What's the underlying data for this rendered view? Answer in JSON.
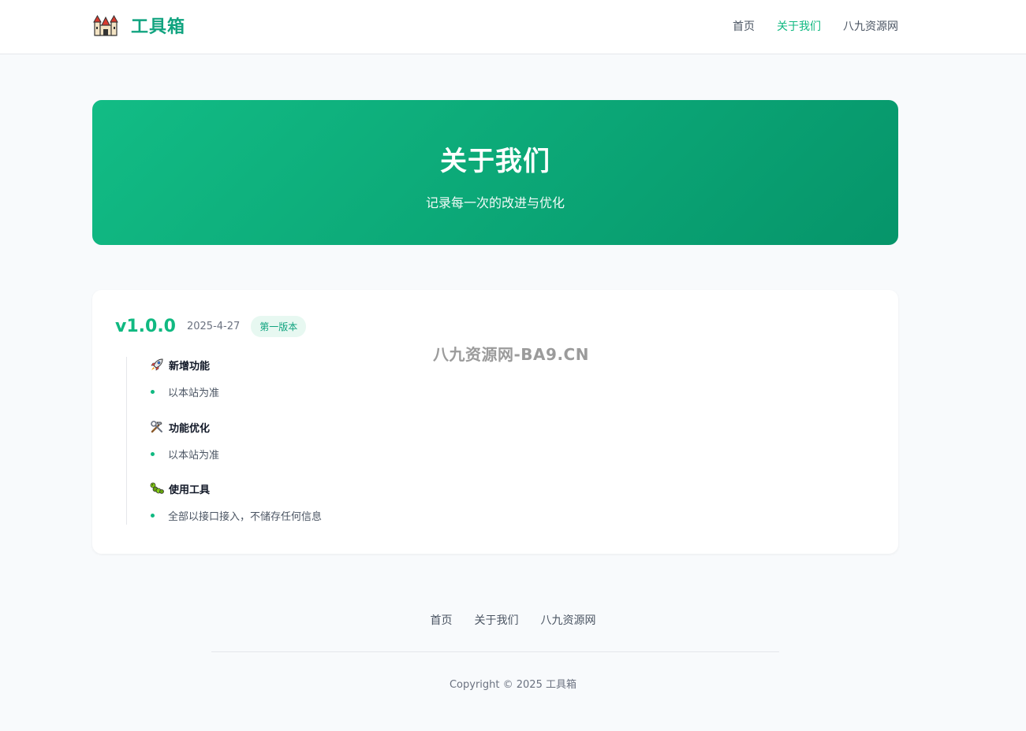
{
  "header": {
    "logo_text": "工具箱",
    "logo_icon": "castle-icon",
    "nav": [
      {
        "label": "首页",
        "active": false
      },
      {
        "label": "关于我们",
        "active": true
      },
      {
        "label": "八九资源网",
        "active": false
      }
    ]
  },
  "hero": {
    "title": "关于我们",
    "subtitle": "记录每一次的改进与优化"
  },
  "version": {
    "number": "v1.0.0",
    "date": "2025-4-27",
    "badge": "第一版本",
    "sections": [
      {
        "icon": "rocket-icon",
        "title": "新增功能",
        "items": [
          "以本站为准"
        ]
      },
      {
        "icon": "tools-icon",
        "title": "功能优化",
        "items": [
          "以本站为准"
        ]
      },
      {
        "icon": "bug-icon",
        "title": "使用工具",
        "items": [
          "全部以接口接入，不储存任何信息"
        ]
      }
    ]
  },
  "watermark": "八九资源网-BA9.CN",
  "footer": {
    "nav": [
      "首页",
      "关于我们",
      "八九资源网"
    ],
    "copyright": "Copyright © 2025 工具箱"
  },
  "colors": {
    "accent": "#10b981",
    "hero_start": "#12bc85",
    "hero_end": "#06956a",
    "background": "#f8fafc"
  }
}
